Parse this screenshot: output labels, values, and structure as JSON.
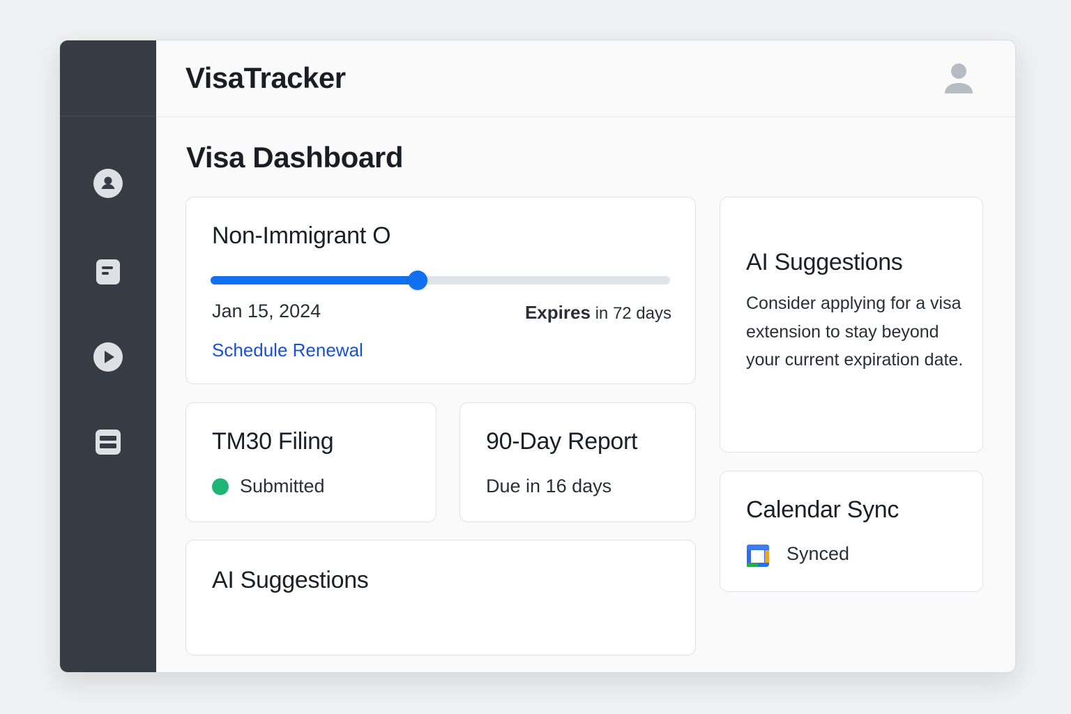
{
  "app": {
    "title": "VisaTracker"
  },
  "header": {
    "avatar_icon": "user-icon"
  },
  "sidebar": {
    "items": [
      {
        "name": "profile",
        "icon": "user-circle-icon"
      },
      {
        "name": "documents",
        "icon": "document-icon"
      },
      {
        "name": "play",
        "icon": "play-icon"
      },
      {
        "name": "list",
        "icon": "list-icon"
      }
    ]
  },
  "page": {
    "title": "Visa Dashboard"
  },
  "visa": {
    "type": "Non-Immigrant O",
    "start_date": "Jan 15, 2024",
    "expires_label": "Expires",
    "expires_value": "in 72 days",
    "progress": 0.45,
    "renewal_link": "Schedule Renewal"
  },
  "tm30": {
    "title": "TM30 Filing",
    "status": "Submitted",
    "status_color": "#1fb575"
  },
  "report": {
    "title": "90-Day Report",
    "due": "Due in 16 days"
  },
  "ai_right": {
    "title": "AI Suggestions",
    "text": "Consider applying for a visa extension to stay beyond your current expiration date."
  },
  "ai_bottom": {
    "title": "AI Suggestions"
  },
  "calendar": {
    "title": "Calendar Sync",
    "status": "Synced",
    "icon": "calendar-icon"
  },
  "colors": {
    "accent": "#1170f0",
    "link": "#1a4fd6",
    "sidebar": "#363c44",
    "success": "#1fb575"
  }
}
